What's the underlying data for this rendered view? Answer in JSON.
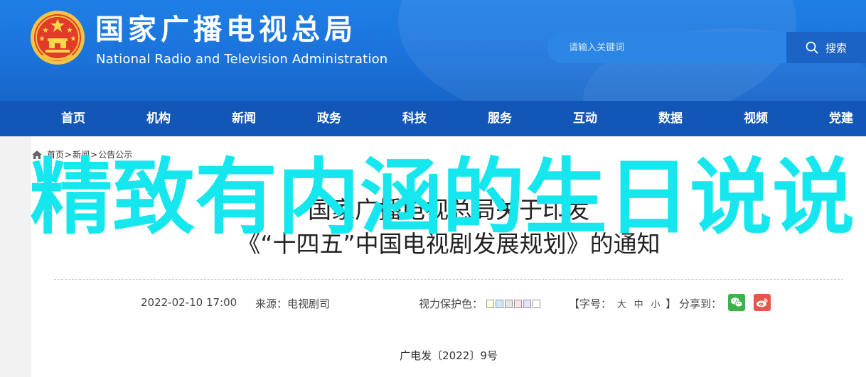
{
  "header": {
    "title": "国家广播电视总局",
    "subtitle": "National Radio and Television Administration",
    "emblem_icon": "national-emblem-icon"
  },
  "search": {
    "placeholder": "请输入关键词",
    "button_label": "搜索"
  },
  "nav": {
    "items": [
      {
        "label": "首页"
      },
      {
        "label": "机构"
      },
      {
        "label": "新闻"
      },
      {
        "label": "政务"
      },
      {
        "label": "科技"
      },
      {
        "label": "服务"
      },
      {
        "label": "互动"
      },
      {
        "label": "数据"
      },
      {
        "label": "视频"
      },
      {
        "label": "党建"
      }
    ]
  },
  "breadcrumb": {
    "home": "首页",
    "news": "新闻",
    "current": "公告公示",
    "separator": ">"
  },
  "article": {
    "title_line1": "国家广播电视总局关于印发",
    "title_line2": "《“十四五”中国电视剧发展规划》的通知",
    "datetime": "2022-02-10 17:00",
    "source": "来源：电视剧司",
    "eye_protection_label": "视力保护色：",
    "eye_colors": [
      "#ffffe0",
      "#cce8ff",
      "#e6e6e6",
      "#ffe0ea",
      "#e8e0ff",
      "#ffffff"
    ],
    "font_size_open": "【字号：",
    "font_size_large": "大",
    "font_size_medium": "中",
    "font_size_small": "小",
    "font_size_close": "】",
    "share_label": "分享到：",
    "doc_number": "广电发〔2022〕9号"
  },
  "overlay": {
    "text": "精致有内涵的生日说说"
  },
  "colors": {
    "header_blue": "#1a72d9",
    "nav_blue": "#1257b8",
    "overlay_cyan": "#16e6ee",
    "wechat_green": "#3bb34a",
    "weibo_red": "#e8554a"
  }
}
